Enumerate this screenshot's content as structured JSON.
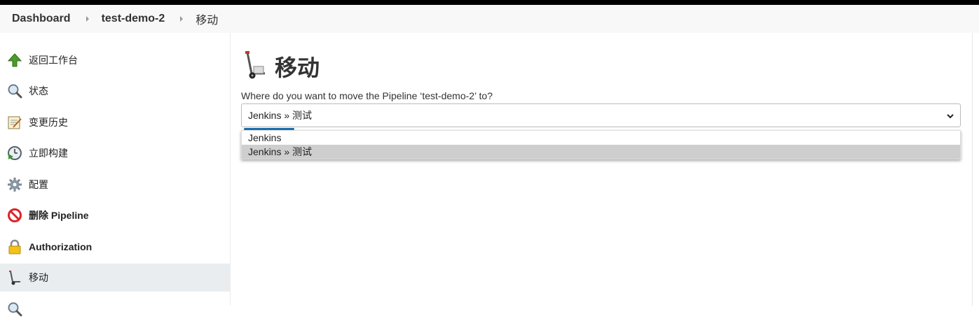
{
  "breadcrumbs": [
    {
      "label": "Dashboard"
    },
    {
      "label": "test-demo-2"
    },
    {
      "label": "移动"
    }
  ],
  "sidebar": {
    "items": [
      {
        "label": "返回工作台",
        "icon": "green-up-arrow-icon"
      },
      {
        "label": "状态",
        "icon": "magnifier-icon"
      },
      {
        "label": "变更历史",
        "icon": "notepad-icon"
      },
      {
        "label": "立即构建",
        "icon": "clock-play-icon"
      },
      {
        "label": "配置",
        "icon": "gear-icon"
      },
      {
        "label": "删除 Pipeline",
        "icon": "no-entry-icon"
      },
      {
        "label": "Authorization",
        "icon": "lock-icon"
      },
      {
        "label": "移动",
        "icon": "hand-truck-icon"
      },
      {
        "label": "",
        "icon": "magnifier-icon"
      }
    ]
  },
  "main": {
    "title": "移动",
    "title_icon": "hand-truck-icon",
    "question": "Where do you want to move the Pipeline ‘test-demo-2’ to?",
    "select_value": "Jenkins » 测试",
    "options": [
      {
        "label": "Jenkins"
      },
      {
        "label": "Jenkins » 测试",
        "selected": true
      }
    ]
  },
  "colors": {
    "accent": "#1a6fb0",
    "active_sidebar": "#e9edf0",
    "selected_option": "#cecece"
  }
}
